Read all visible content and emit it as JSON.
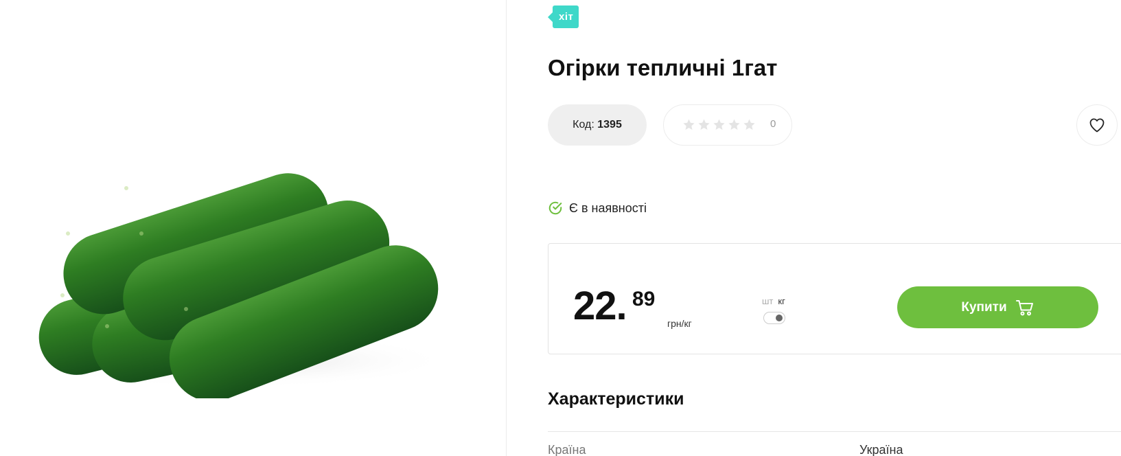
{
  "product": {
    "badge": "хіт",
    "title": "Огірки тепличні 1гат",
    "code_label": "Код:",
    "code_value": "1395",
    "rating_count": "0",
    "rating_stars": 0,
    "availability": "Є в наявності",
    "image_icon": "cucumbers-photo"
  },
  "price": {
    "integer": "22.",
    "fraction": "89",
    "unit": "грн/кг"
  },
  "unit_switch": {
    "option_piece": "шт",
    "option_kg": "кг",
    "selected": "кг"
  },
  "buy_button": {
    "label": "Купити",
    "icon": "cart-icon"
  },
  "characteristics": {
    "title": "Характеристики",
    "rows": [
      {
        "key": "Країна",
        "value": "Україна"
      }
    ]
  },
  "colors": {
    "accent_green": "#6ebf3e",
    "badge_teal": "#3fd8c9",
    "check_green": "#6ebf3e"
  }
}
